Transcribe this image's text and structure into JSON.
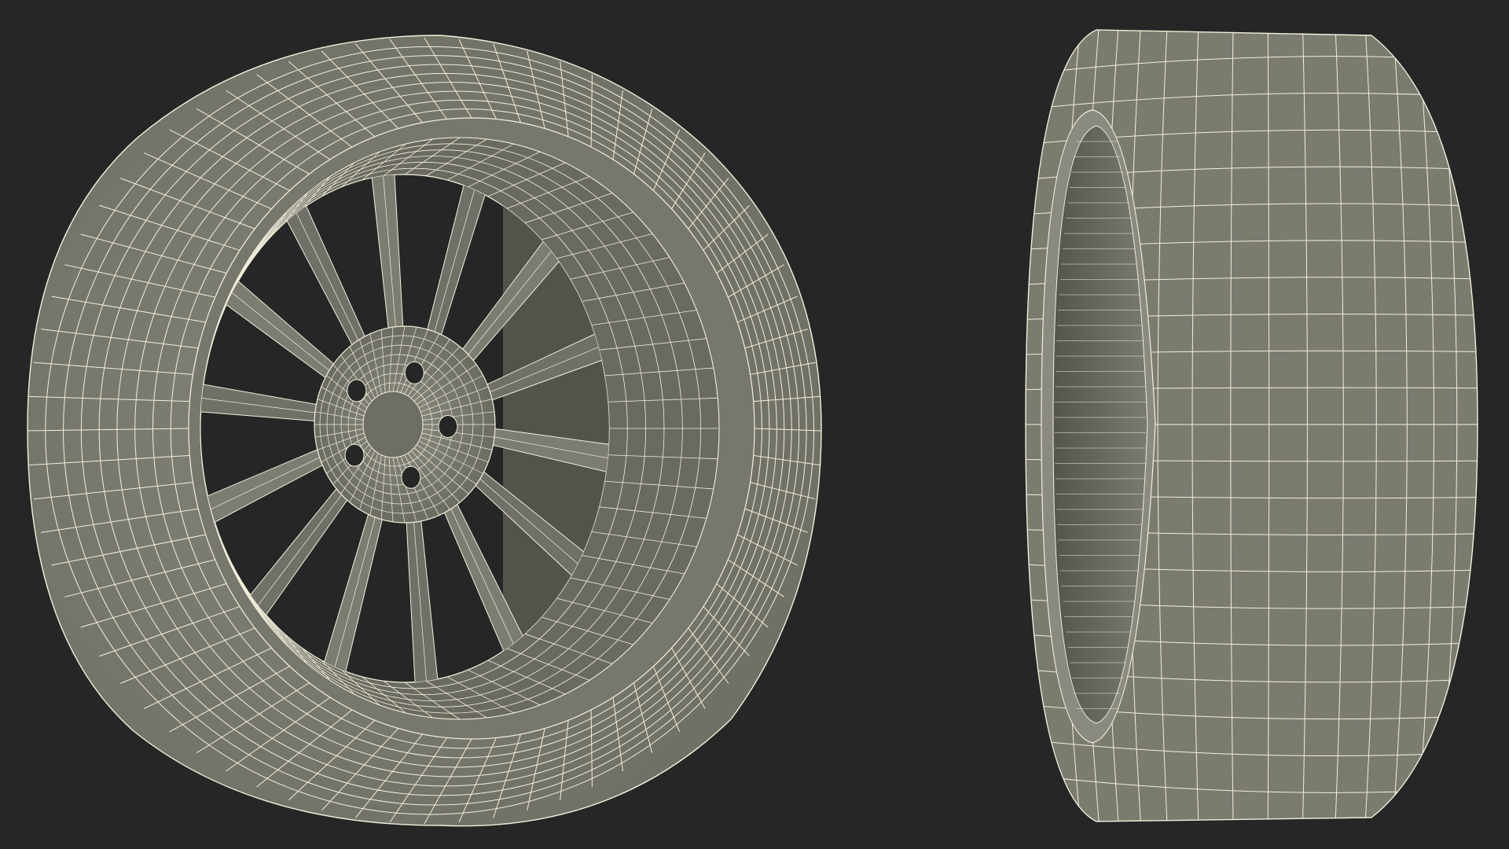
{
  "scene": {
    "background_color": "#262626",
    "mesh_surface_color": "#7b7b70",
    "mesh_shadow_color": "#4f4f48",
    "wireframe_color": "#f2f0dc",
    "objects": [
      {
        "name": "wheel-front-three-quarter",
        "parts": [
          "tire",
          "rim",
          "spokes",
          "hub",
          "lug-holes"
        ],
        "spoke_count": 14,
        "lug_hole_count": 5
      },
      {
        "name": "tire-side-view",
        "parts": [
          "tire",
          "inner-bore"
        ]
      }
    ]
  }
}
